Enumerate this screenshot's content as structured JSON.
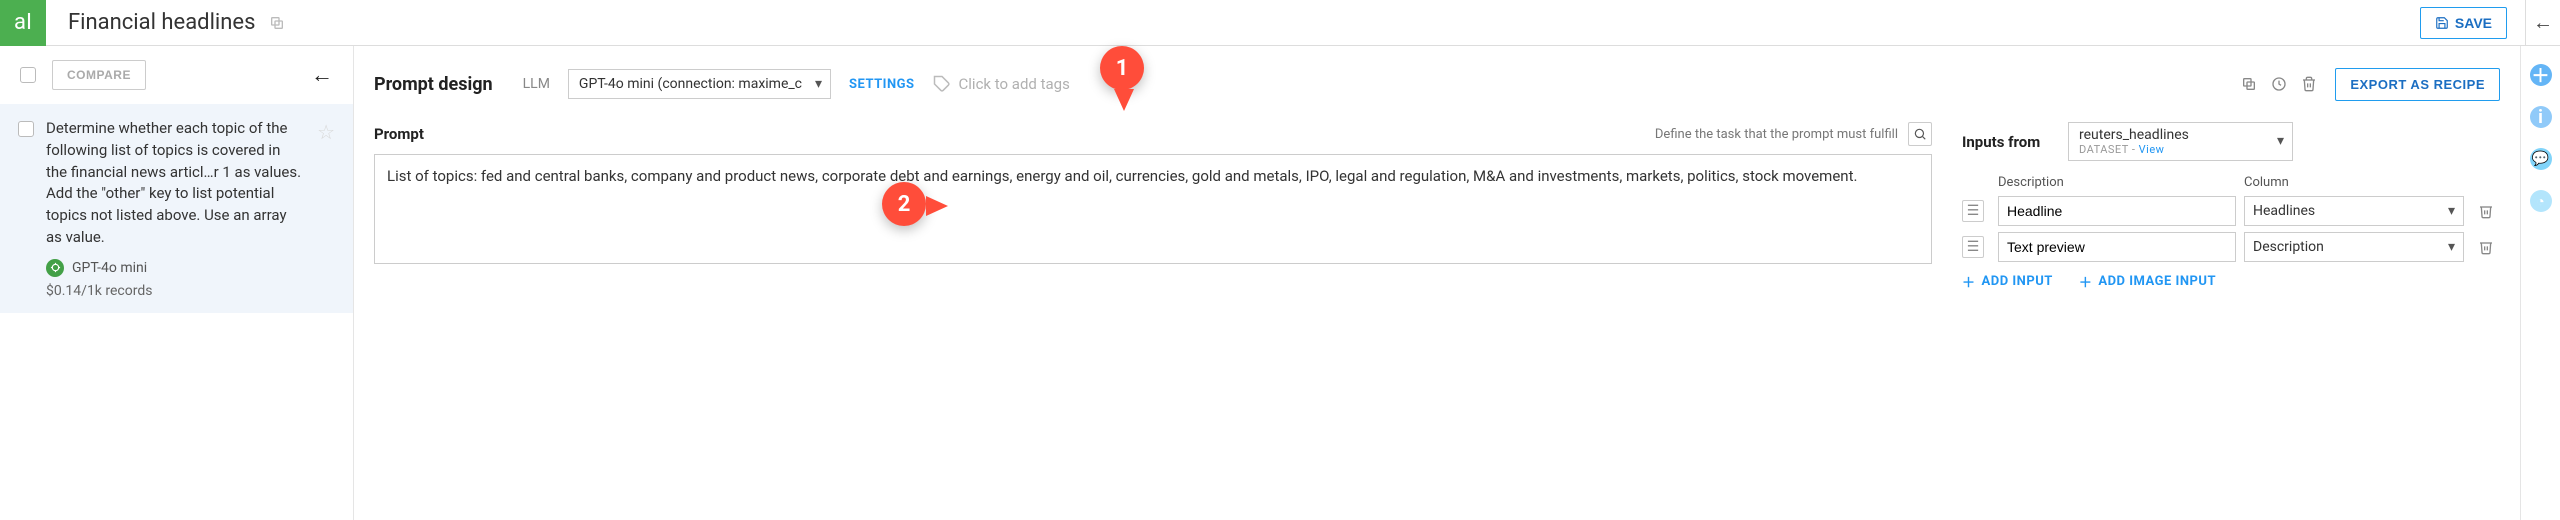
{
  "header": {
    "page_title": "Financial headlines",
    "save_label": "SAVE"
  },
  "left": {
    "compare_label": "COMPARE",
    "card": {
      "text": "Determine whether each topic of the following list of topics is covered in the financial news articl…r 1 as values. Add the \"other\" key to list potential topics not listed above. Use an array as value.",
      "model": "GPT-4o mini",
      "cost": "$0.14/1k records"
    }
  },
  "main": {
    "section_title": "Prompt design",
    "llm_label": "LLM",
    "llm_value": "GPT-4o mini (connection: maxime_c",
    "settings_label": "SETTINGS",
    "tags_placeholder": "Click to add tags",
    "export_label": "EXPORT AS RECIPE",
    "prompt_label": "Prompt",
    "prompt_hint": "Define the task that the prompt must fulfill",
    "prompt_text": "List of topics: fed and central banks, company and product news, corporate debt and earnings, energy and oil, currencies, gold and metals, IPO, legal and regulation, M&A and investments, markets, politics, stock movement."
  },
  "inputs": {
    "label": "Inputs from",
    "dataset_name": "reuters_headlines",
    "dataset_type": "DATASET",
    "view_label": "View",
    "col_description": "Description",
    "col_column": "Column",
    "rows": [
      {
        "description": "Headline",
        "column": "Headlines"
      },
      {
        "description": "Text preview",
        "column": "Description"
      }
    ],
    "add_input_label": "ADD INPUT",
    "add_image_label": "ADD IMAGE INPUT"
  },
  "callouts": {
    "pin1": "1",
    "pin2": "2"
  }
}
